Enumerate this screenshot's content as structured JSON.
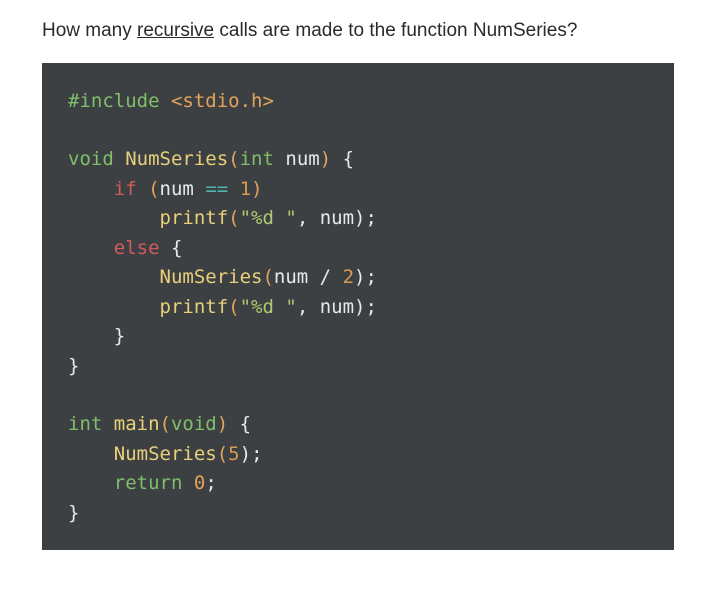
{
  "question": {
    "pre": "How many ",
    "underlined": "recursive",
    "post": " calls are made to the function NumSeries?"
  },
  "code": {
    "l01_include": "#include",
    "l01_header": " <stdio.h>",
    "l03_void": "void",
    "l03_name": " NumSeries",
    "l03_open": "(",
    "l03_int": "int",
    "l03_param": " num",
    "l03_close": ")",
    "l03_brace": " {",
    "l04_indent": "    ",
    "l04_if": "if",
    "l04_open": " (",
    "l04_lhs": "num ",
    "l04_op": "==",
    "l04_space": " ",
    "l04_rhs": "1",
    "l04_close": ")",
    "l05_indent": "        ",
    "l05_printf": "printf",
    "l05_open": "(",
    "l05_str": "\"%d \"",
    "l05_rest": ", num);",
    "l06_indent": "    ",
    "l06_else": "else",
    "l06_brace": " {",
    "l07_indent": "        ",
    "l07_call": "NumSeries",
    "l07_open": "(",
    "l07_arg": "num / ",
    "l07_num": "2",
    "l07_close": ");",
    "l08_indent": "        ",
    "l08_printf": "printf",
    "l08_open": "(",
    "l08_str": "\"%d \"",
    "l08_rest": ", num);",
    "l09_indent": "    ",
    "l09_brace": "}",
    "l10_brace": "}",
    "l12_int": "int",
    "l12_name": " main",
    "l12_open": "(",
    "l12_void": "void",
    "l12_close": ")",
    "l12_brace": " {",
    "l13_indent": "    ",
    "l13_call": "NumSeries",
    "l13_open": "(",
    "l13_arg": "5",
    "l13_close": ");",
    "l14_indent": "    ",
    "l14_return": "return",
    "l14_space": " ",
    "l14_zero": "0",
    "l14_semi": ";",
    "l15_brace": "}"
  }
}
